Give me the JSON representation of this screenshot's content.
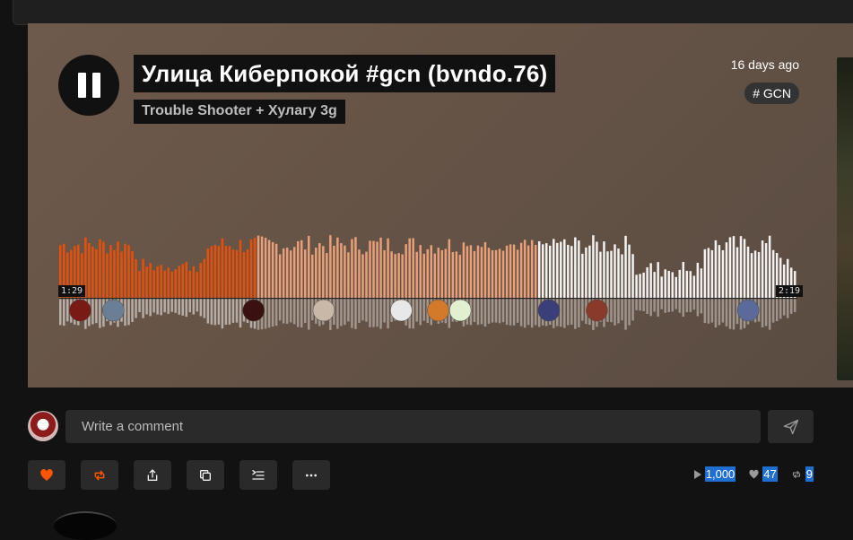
{
  "track": {
    "title": "Улица Киберпокой #gcn (bvndo.76)",
    "artist": "Trouble Shooter + Хулагу 3g",
    "posted": "16 days ago",
    "tag": "# GCN",
    "state": "playing",
    "elapsed": "1:29",
    "duration": "2:19",
    "progress_fraction": 0.265,
    "buffered_fraction": 0.645
  },
  "comment": {
    "placeholder": "Write a comment"
  },
  "actions": [
    "like-button",
    "repost-button",
    "share-button",
    "copy-link-button",
    "add-to-playlist-button",
    "more-button"
  ],
  "stats": {
    "plays": "1,000",
    "likes": "47",
    "reposts": "9"
  },
  "colors": {
    "played": "#e8500a",
    "buffered": "#e9a07a",
    "unplayed": "#f2f2f2",
    "accent": "#ff5500",
    "selection": "#1f6fd1"
  }
}
